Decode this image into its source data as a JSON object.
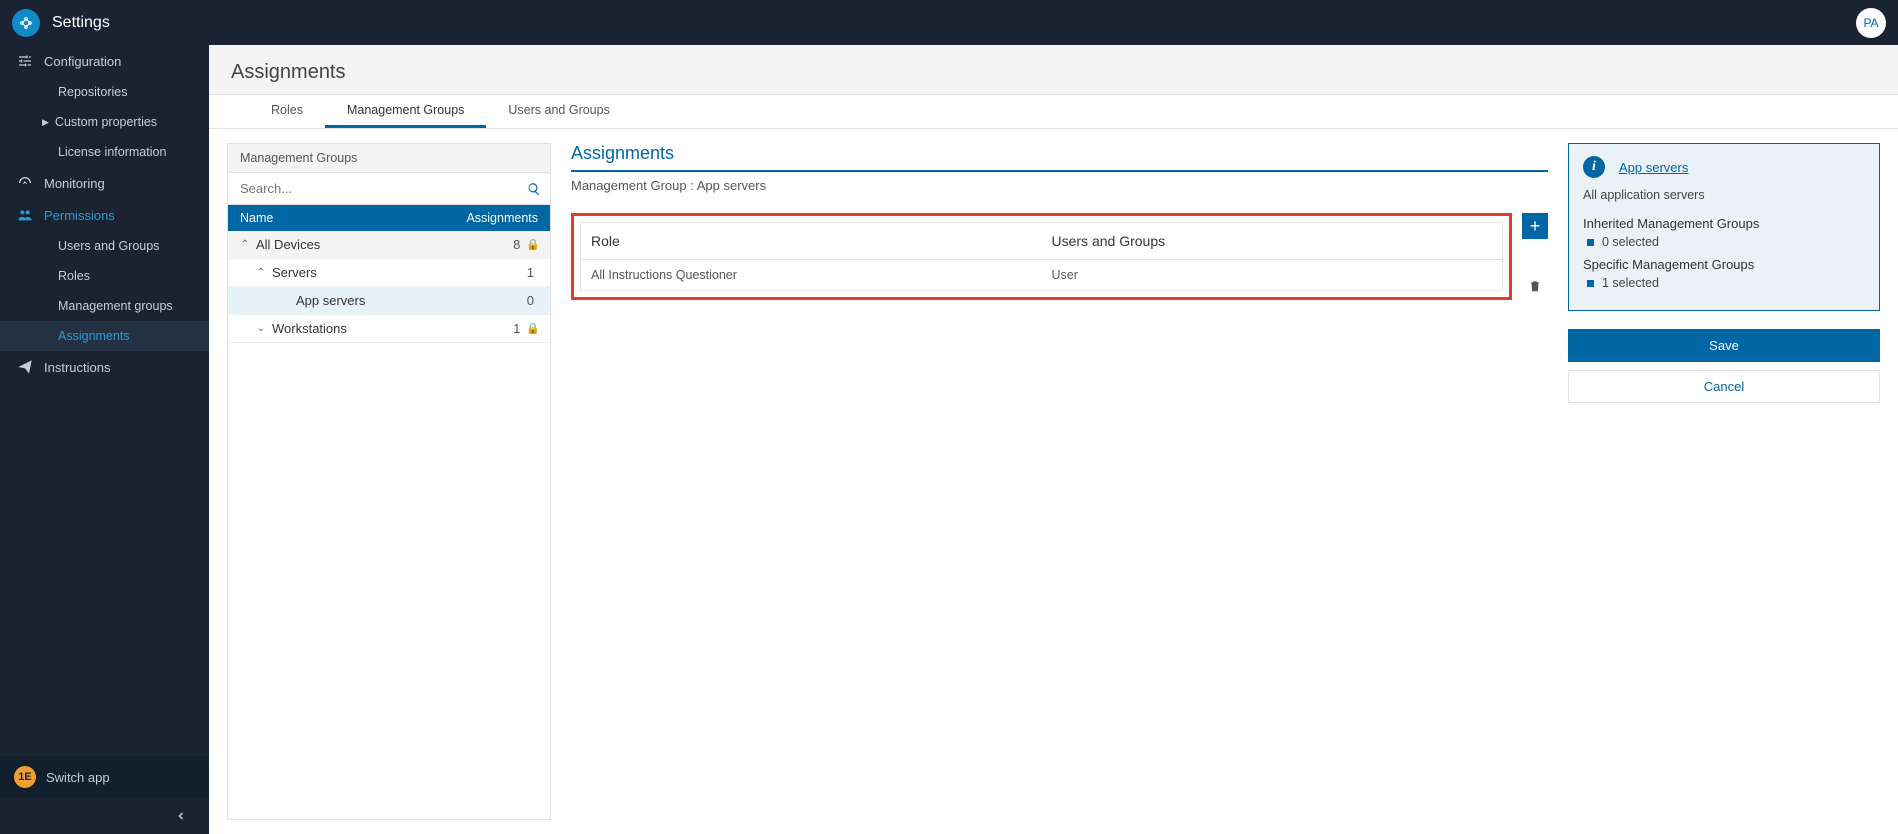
{
  "header": {
    "title": "Settings",
    "avatar": "PA"
  },
  "sidebar": {
    "sections": [
      {
        "label": "Configuration",
        "icon": "sliders",
        "children": [
          {
            "label": "Repositories"
          },
          {
            "label": "Custom properties",
            "pre": "▶"
          },
          {
            "label": "License information"
          }
        ]
      },
      {
        "label": "Monitoring",
        "icon": "gauge",
        "children": []
      },
      {
        "label": "Permissions",
        "icon": "users",
        "active": true,
        "children": [
          {
            "label": "Users and Groups"
          },
          {
            "label": "Roles"
          },
          {
            "label": "Management groups"
          },
          {
            "label": "Assignments",
            "active": true
          }
        ]
      },
      {
        "label": "Instructions",
        "icon": "send",
        "children": []
      }
    ],
    "switch_app": "Switch app"
  },
  "page": {
    "title": "Assignments"
  },
  "tabs": [
    {
      "label": "Roles"
    },
    {
      "label": "Management Groups",
      "active": true
    },
    {
      "label": "Users and Groups"
    }
  ],
  "tree": {
    "header": "Management Groups",
    "search_placeholder": "Search...",
    "col_name": "Name",
    "col_assign": "Assignments",
    "rows": [
      {
        "label": "All Devices",
        "count": "8",
        "lock": true,
        "depth": 0,
        "chev": "up"
      },
      {
        "label": "Servers",
        "count": "1",
        "depth": 1,
        "chev": "up"
      },
      {
        "label": "App servers",
        "count": "0",
        "depth": 2,
        "selected": true
      },
      {
        "label": "Workstations",
        "count": "1",
        "lock": true,
        "depth": 1,
        "chev": "down"
      }
    ]
  },
  "assignments": {
    "title": "Assignments",
    "subtitle": "Management Group : App servers",
    "col_role": "Role",
    "col_users": "Users and Groups",
    "rows": [
      {
        "role": "All Instructions Questioner",
        "users": "User"
      }
    ]
  },
  "info": {
    "link": "App servers",
    "desc": "All application servers",
    "inherited_label": "Inherited Management Groups",
    "inherited_count": "0 selected",
    "specific_label": "Specific Management Groups",
    "specific_count": "1 selected"
  },
  "actions": {
    "save": "Save",
    "cancel": "Cancel"
  }
}
